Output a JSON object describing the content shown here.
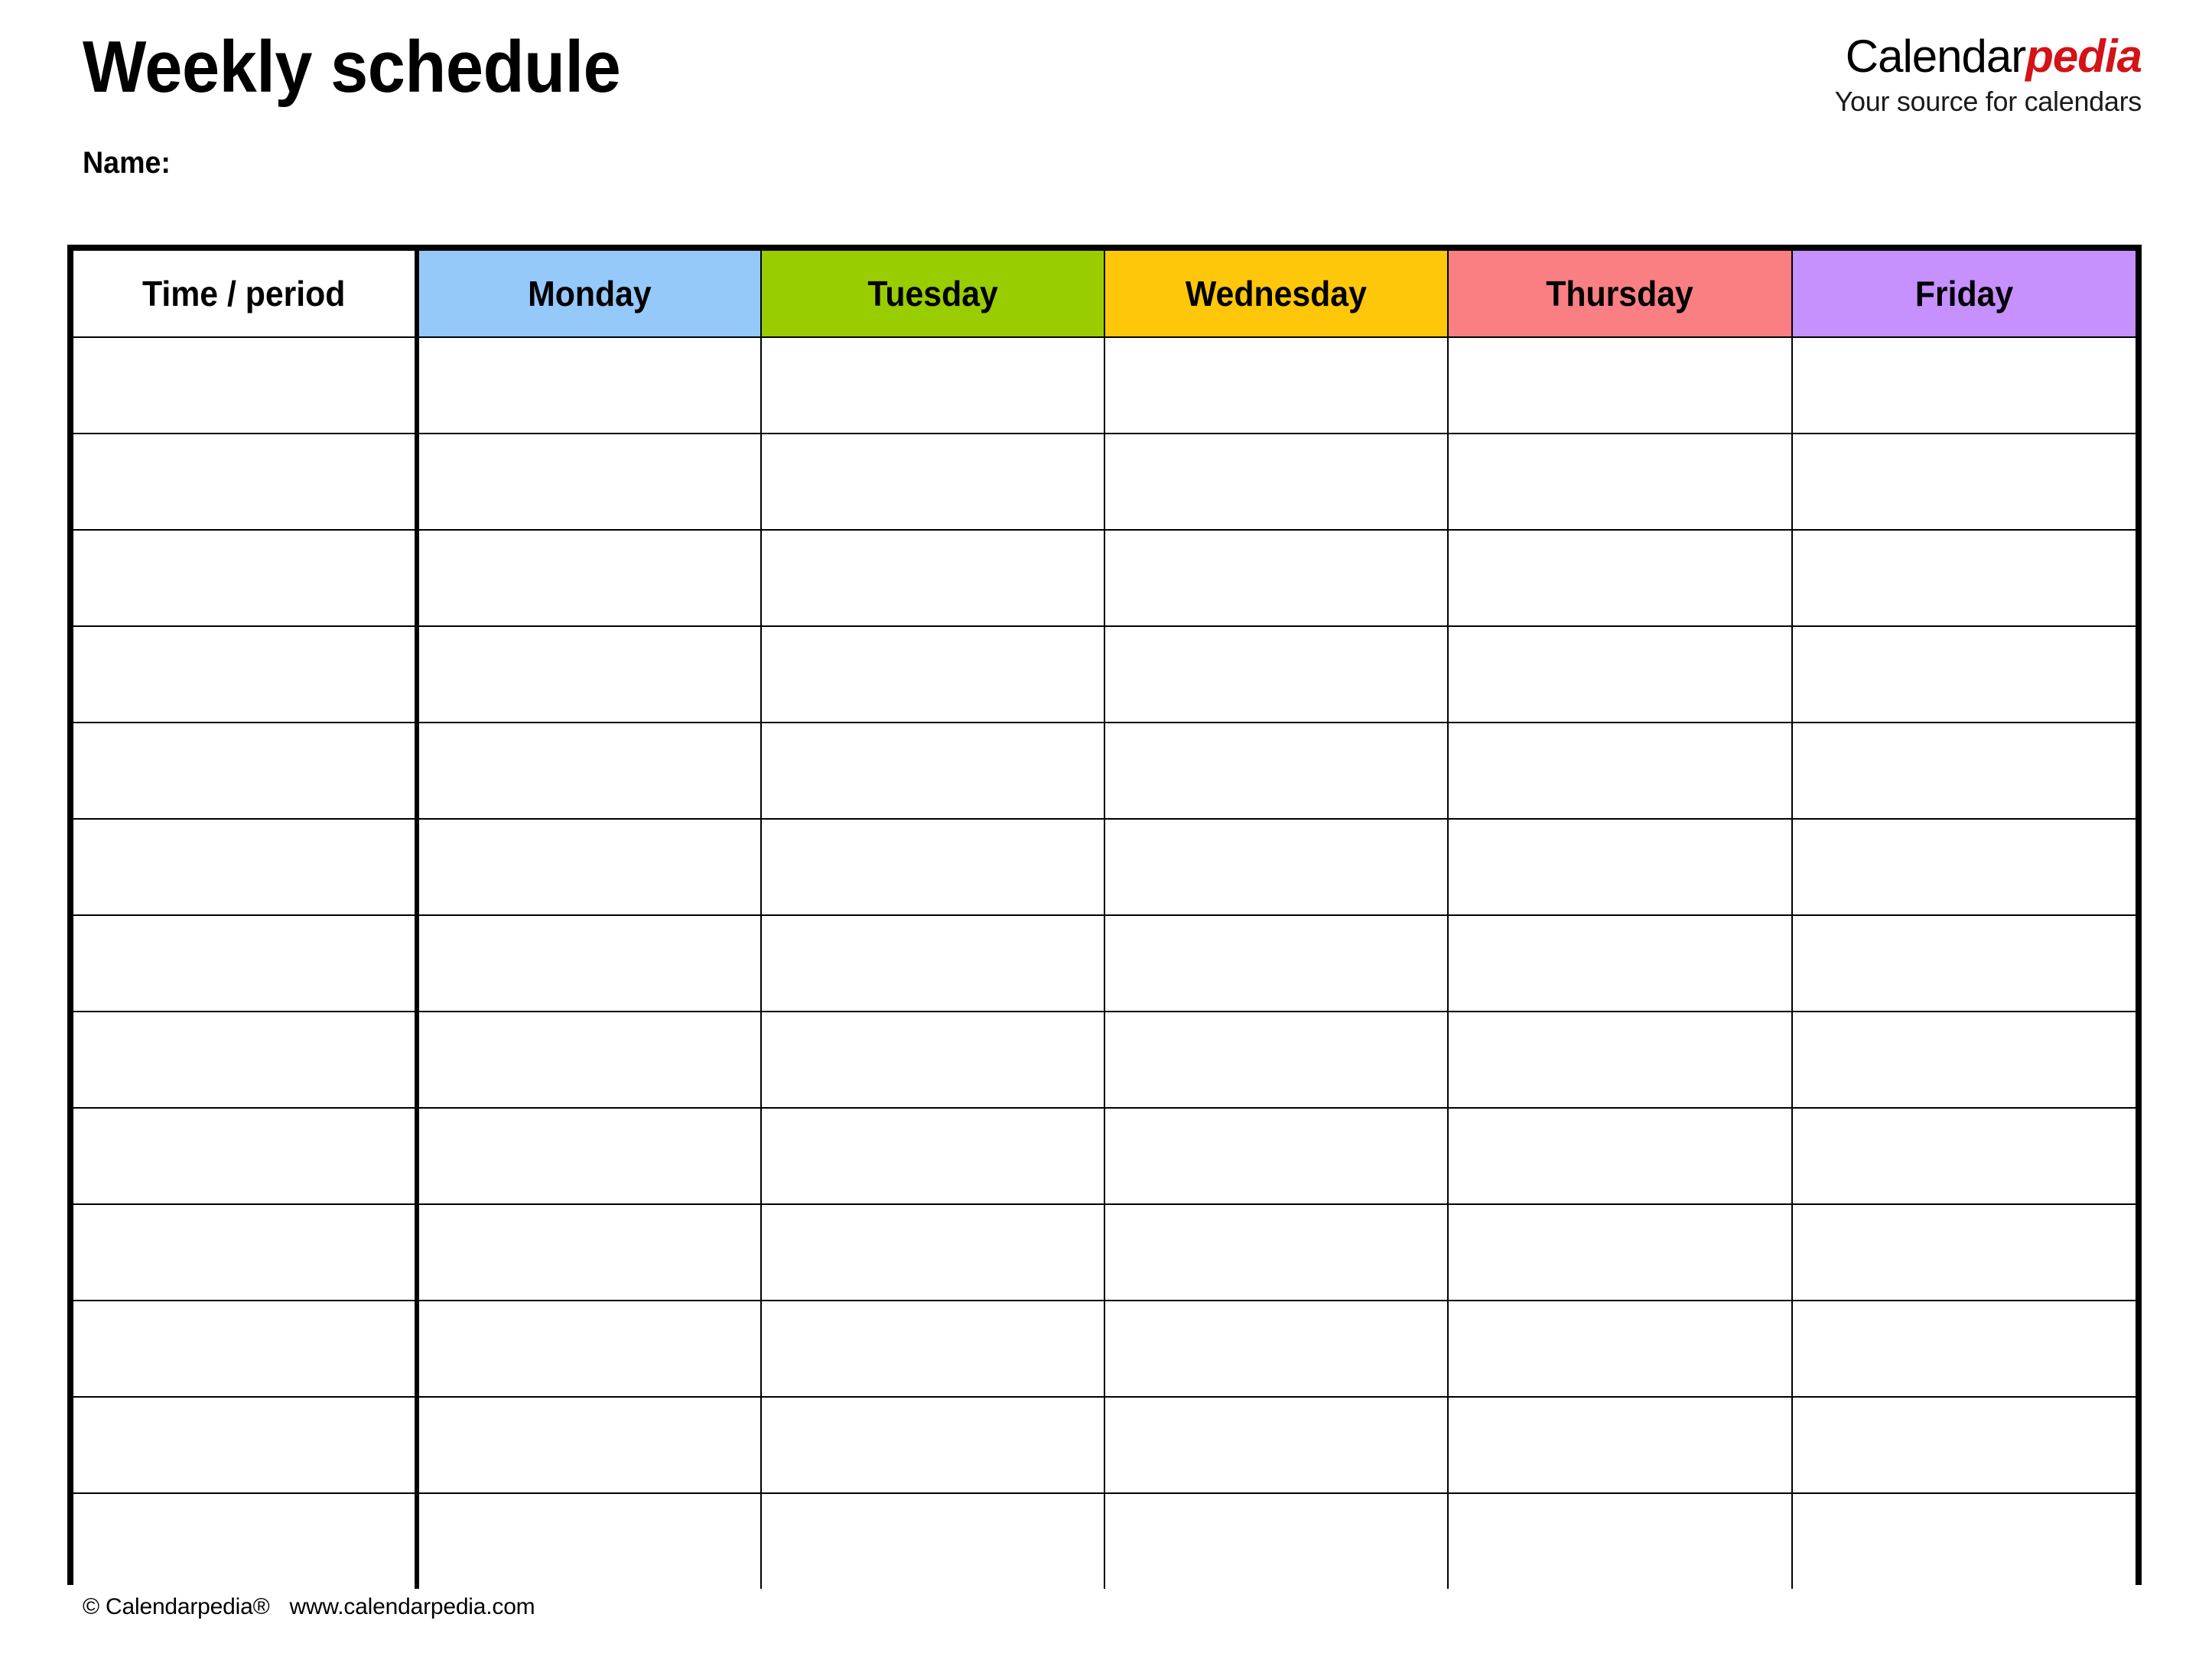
{
  "document": {
    "title": "Weekly schedule",
    "name_label": "Name:"
  },
  "brand": {
    "name_part1": "Calendar",
    "name_part2": "pedia",
    "tagline": "Your source for calendars",
    "accent_color": "#d41217"
  },
  "table": {
    "columns": [
      {
        "label": "Time / period",
        "bg": "#ffffff"
      },
      {
        "label": "Monday",
        "bg": "#94c9fa"
      },
      {
        "label": "Tuesday",
        "bg": "#9acd00"
      },
      {
        "label": "Wednesday",
        "bg": "#ffc709"
      },
      {
        "label": "Thursday",
        "bg": "#fa7f82"
      },
      {
        "label": "Friday",
        "bg": "#c690fe"
      }
    ],
    "row_count": 13,
    "rows": [
      [
        "",
        "",
        "",
        "",
        "",
        ""
      ],
      [
        "",
        "",
        "",
        "",
        "",
        ""
      ],
      [
        "",
        "",
        "",
        "",
        "",
        ""
      ],
      [
        "",
        "",
        "",
        "",
        "",
        ""
      ],
      [
        "",
        "",
        "",
        "",
        "",
        ""
      ],
      [
        "",
        "",
        "",
        "",
        "",
        ""
      ],
      [
        "",
        "",
        "",
        "",
        "",
        ""
      ],
      [
        "",
        "",
        "",
        "",
        "",
        ""
      ],
      [
        "",
        "",
        "",
        "",
        "",
        ""
      ],
      [
        "",
        "",
        "",
        "",
        "",
        ""
      ],
      [
        "",
        "",
        "",
        "",
        "",
        ""
      ],
      [
        "",
        "",
        "",
        "",
        "",
        ""
      ],
      [
        "",
        "",
        "",
        "",
        "",
        ""
      ]
    ]
  },
  "footer": {
    "copyright": "© Calendarpedia®",
    "website": "www.calendarpedia.com"
  }
}
